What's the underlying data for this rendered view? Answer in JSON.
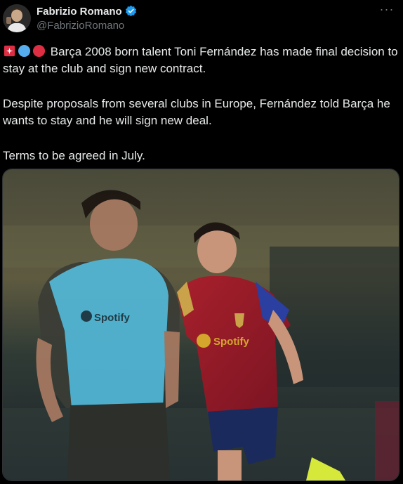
{
  "author": {
    "display_name": "Fabrizio Romano",
    "handle": "@FabrizioRomano",
    "verified": true,
    "verified_icon": "verified-badge-icon",
    "accent_color": "#1d9bf0"
  },
  "tweet": {
    "emojis": [
      "siren-emoji",
      "blue-circle-emoji",
      "red-circle-emoji"
    ],
    "paragraph_1": "Barça 2008 born talent Toni Fernández has made final decision to stay at the club and sign new contract.",
    "paragraph_2": "Despite proposals from several clubs in Europe, Fernández told Barça he wants to stay and he will sign new deal.",
    "paragraph_3": "Terms to be agreed in July."
  },
  "media": {
    "sponsor_text": "Spotify"
  },
  "menu": {
    "more_label": "···"
  }
}
